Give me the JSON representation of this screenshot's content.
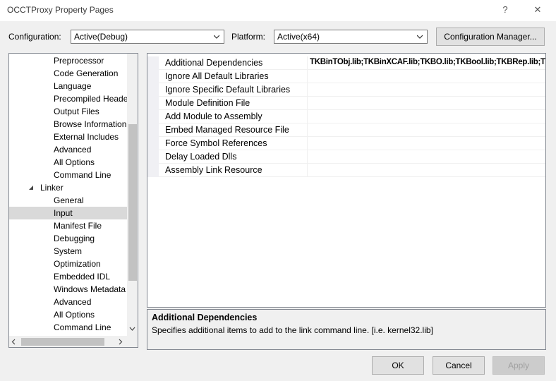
{
  "window": {
    "title": "OCCTProxy Property Pages",
    "help_glyph": "?",
    "close_glyph": "✕"
  },
  "toolbar": {
    "configuration_label": "Configuration:",
    "configuration_value": "Active(Debug)",
    "platform_label": "Platform:",
    "platform_value": "Active(x64)",
    "config_manager_label": "Configuration Manager..."
  },
  "tree": {
    "linker_label": "Linker",
    "items_before": [
      "Preprocessor",
      "Code Generation",
      "Language",
      "Precompiled Heade",
      "Output Files",
      "Browse Information",
      "External Includes",
      "Advanced",
      "All Options",
      "Command Line"
    ],
    "items_after": [
      "General",
      "Input",
      "Manifest File",
      "Debugging",
      "System",
      "Optimization",
      "Embedded IDL",
      "Windows Metadata",
      "Advanced",
      "All Options",
      "Command Line"
    ],
    "selected": "Input"
  },
  "properties": [
    {
      "name": "Additional Dependencies",
      "value": "TKBinTObj.lib;TKBinXCAF.lib;TKBO.lib;TKBool.lib;TKBRep.lib;TKCAF.lib"
    },
    {
      "name": "Ignore All Default Libraries",
      "value": ""
    },
    {
      "name": "Ignore Specific Default Libraries",
      "value": ""
    },
    {
      "name": "Module Definition File",
      "value": ""
    },
    {
      "name": "Add Module to Assembly",
      "value": ""
    },
    {
      "name": "Embed Managed Resource File",
      "value": ""
    },
    {
      "name": "Force Symbol References",
      "value": ""
    },
    {
      "name": "Delay Loaded Dlls",
      "value": ""
    },
    {
      "name": "Assembly Link Resource",
      "value": ""
    }
  ],
  "description": {
    "title": "Additional Dependencies",
    "text": "Specifies additional items to add to the link command line. [i.e. kernel32.lib]"
  },
  "buttons": {
    "ok": "OK",
    "cancel": "Cancel",
    "apply": "Apply"
  },
  "colors": {
    "selection": "#cce8ff",
    "window_bg": "#f0f0f0"
  }
}
